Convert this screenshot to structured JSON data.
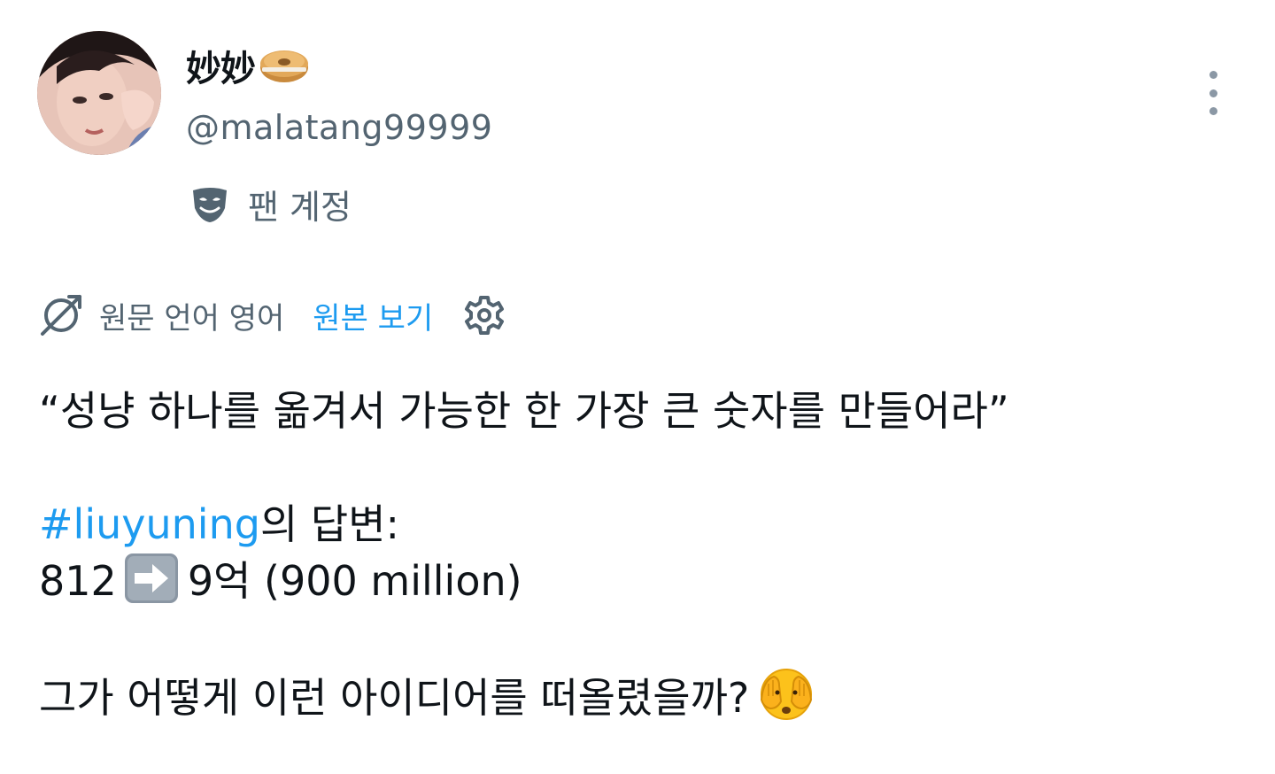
{
  "user": {
    "display_name": "妙妙",
    "display_name_emoji": "bagel-emoji",
    "handle": "@malatang99999",
    "fan_label": "팬 계정",
    "fan_icon": "mask-icon"
  },
  "translation": {
    "source_text": "원문 언어 영어",
    "show_original": "원본 보기",
    "icon": "translate-icon",
    "settings_icon": "gear-icon"
  },
  "tweet": {
    "line1": "“성냥 하나를 옮겨서 가능한 한 가장 큰 숫자를 만들어라”",
    "hashtag": "#liuyuning",
    "answer_suffix": "의 답변:",
    "number_from": "812",
    "arrow_emoji": "right-arrow-emoji",
    "number_to": "9억 (900 million)",
    "question": "그가 어떻게 이런 아이디어를 떠올렸을까?",
    "end_emoji": "face-with-hands-over-eyes-emoji"
  },
  "colors": {
    "link": "#1d9bf0",
    "secondary_text": "#536471",
    "primary_text": "#0f1419"
  }
}
